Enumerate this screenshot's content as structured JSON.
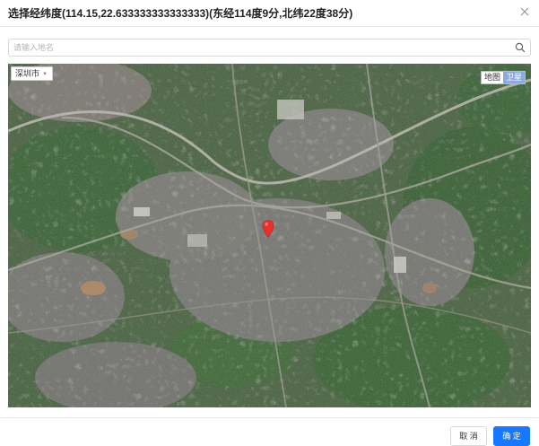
{
  "dialog": {
    "title": "选择经纬度(114.15,22.633333333333333)(东经114度9分,北纬22度38分)",
    "close_icon": "close-icon"
  },
  "search": {
    "placeholder": "请输入地名",
    "value": "",
    "icon": "search-icon"
  },
  "map": {
    "city": "深圳市",
    "type_map": "地图",
    "type_satellite": "卫星",
    "active_type": "卫星",
    "marker_color": "#e8322d"
  },
  "footer": {
    "cancel_label": "取 消",
    "ok_label": "确 定",
    "ok_color": "#1677ff"
  }
}
